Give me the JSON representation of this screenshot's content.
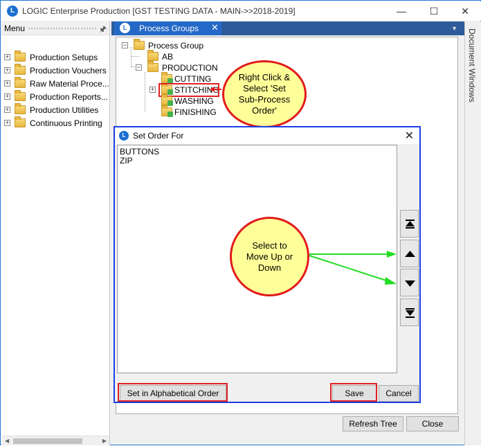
{
  "window": {
    "title": "LOGIC Enterprise Production  [GST TESTING DATA - MAIN->>2018-2019]",
    "logo": "L",
    "minimize_icon": "—",
    "maximize_icon": "☐",
    "close_icon": "✕"
  },
  "sidebar": {
    "header": "Menu",
    "pin_icon": "🖈",
    "items": [
      {
        "label": "Production Setups"
      },
      {
        "label": "Production Vouchers"
      },
      {
        "label": "Raw  Material  Proce..."
      },
      {
        "label": "Production  Reports..."
      },
      {
        "label": "Production Utilities"
      },
      {
        "label": "Continuous Printing"
      }
    ]
  },
  "tab": {
    "label": "Process Groups",
    "close_icon": "✕"
  },
  "docwin_label": "Document Windows",
  "tree": {
    "root": "Process Group",
    "ab": "AB",
    "production": "PRODUCTION",
    "children": [
      "CUTTING",
      "STITCHING",
      "WASHING",
      "FINISHING"
    ]
  },
  "dialog": {
    "title": "Set Order For",
    "close_icon": "✕",
    "items": [
      "BUTTONS",
      "ZIP"
    ],
    "alpha_button": "Set in Alphabetical Order",
    "save_button": "Save",
    "cancel_button": "Cancel"
  },
  "callouts": {
    "right_click": "Right Click &\nSelect 'Set\nSub-Process\nOrder'",
    "select_move": "Select to\nMove Up or\nDown"
  },
  "footer": {
    "refresh_button": "Refresh Tree",
    "close_button": "Close"
  },
  "colors": {
    "highlight": "#e02020",
    "arrow": "#22dd22",
    "dialog_border": "#1b3ee5",
    "callout_fill": "#ffff99"
  }
}
